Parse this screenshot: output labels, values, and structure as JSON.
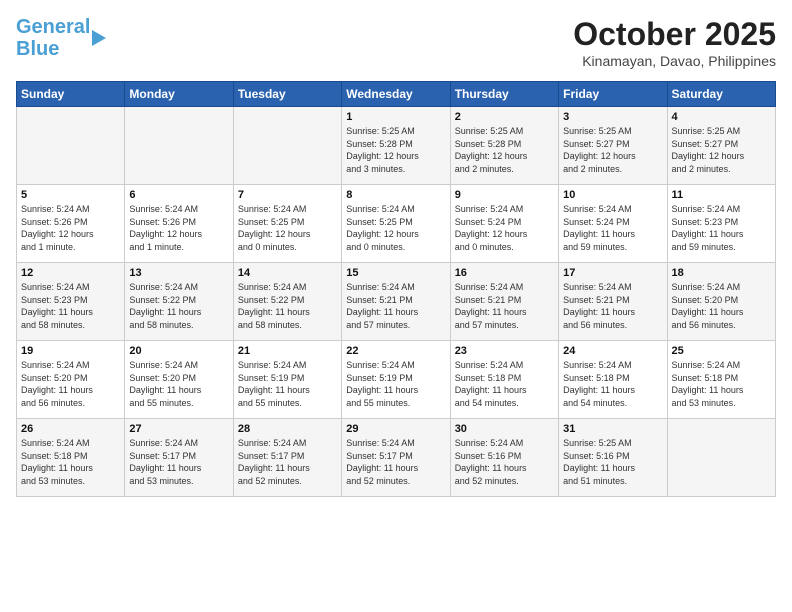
{
  "header": {
    "logo_line1": "General",
    "logo_line2": "Blue",
    "month_title": "October 2025",
    "location": "Kinamayan, Davao, Philippines"
  },
  "weekdays": [
    "Sunday",
    "Monday",
    "Tuesday",
    "Wednesday",
    "Thursday",
    "Friday",
    "Saturday"
  ],
  "weeks": [
    [
      {
        "day": "",
        "info": ""
      },
      {
        "day": "",
        "info": ""
      },
      {
        "day": "",
        "info": ""
      },
      {
        "day": "1",
        "info": "Sunrise: 5:25 AM\nSunset: 5:28 PM\nDaylight: 12 hours\nand 3 minutes."
      },
      {
        "day": "2",
        "info": "Sunrise: 5:25 AM\nSunset: 5:28 PM\nDaylight: 12 hours\nand 2 minutes."
      },
      {
        "day": "3",
        "info": "Sunrise: 5:25 AM\nSunset: 5:27 PM\nDaylight: 12 hours\nand 2 minutes."
      },
      {
        "day": "4",
        "info": "Sunrise: 5:25 AM\nSunset: 5:27 PM\nDaylight: 12 hours\nand 2 minutes."
      }
    ],
    [
      {
        "day": "5",
        "info": "Sunrise: 5:24 AM\nSunset: 5:26 PM\nDaylight: 12 hours\nand 1 minute."
      },
      {
        "day": "6",
        "info": "Sunrise: 5:24 AM\nSunset: 5:26 PM\nDaylight: 12 hours\nand 1 minute."
      },
      {
        "day": "7",
        "info": "Sunrise: 5:24 AM\nSunset: 5:25 PM\nDaylight: 12 hours\nand 0 minutes."
      },
      {
        "day": "8",
        "info": "Sunrise: 5:24 AM\nSunset: 5:25 PM\nDaylight: 12 hours\nand 0 minutes."
      },
      {
        "day": "9",
        "info": "Sunrise: 5:24 AM\nSunset: 5:24 PM\nDaylight: 12 hours\nand 0 minutes."
      },
      {
        "day": "10",
        "info": "Sunrise: 5:24 AM\nSunset: 5:24 PM\nDaylight: 11 hours\nand 59 minutes."
      },
      {
        "day": "11",
        "info": "Sunrise: 5:24 AM\nSunset: 5:23 PM\nDaylight: 11 hours\nand 59 minutes."
      }
    ],
    [
      {
        "day": "12",
        "info": "Sunrise: 5:24 AM\nSunset: 5:23 PM\nDaylight: 11 hours\nand 58 minutes."
      },
      {
        "day": "13",
        "info": "Sunrise: 5:24 AM\nSunset: 5:22 PM\nDaylight: 11 hours\nand 58 minutes."
      },
      {
        "day": "14",
        "info": "Sunrise: 5:24 AM\nSunset: 5:22 PM\nDaylight: 11 hours\nand 58 minutes."
      },
      {
        "day": "15",
        "info": "Sunrise: 5:24 AM\nSunset: 5:21 PM\nDaylight: 11 hours\nand 57 minutes."
      },
      {
        "day": "16",
        "info": "Sunrise: 5:24 AM\nSunset: 5:21 PM\nDaylight: 11 hours\nand 57 minutes."
      },
      {
        "day": "17",
        "info": "Sunrise: 5:24 AM\nSunset: 5:21 PM\nDaylight: 11 hours\nand 56 minutes."
      },
      {
        "day": "18",
        "info": "Sunrise: 5:24 AM\nSunset: 5:20 PM\nDaylight: 11 hours\nand 56 minutes."
      }
    ],
    [
      {
        "day": "19",
        "info": "Sunrise: 5:24 AM\nSunset: 5:20 PM\nDaylight: 11 hours\nand 56 minutes."
      },
      {
        "day": "20",
        "info": "Sunrise: 5:24 AM\nSunset: 5:20 PM\nDaylight: 11 hours\nand 55 minutes."
      },
      {
        "day": "21",
        "info": "Sunrise: 5:24 AM\nSunset: 5:19 PM\nDaylight: 11 hours\nand 55 minutes."
      },
      {
        "day": "22",
        "info": "Sunrise: 5:24 AM\nSunset: 5:19 PM\nDaylight: 11 hours\nand 55 minutes."
      },
      {
        "day": "23",
        "info": "Sunrise: 5:24 AM\nSunset: 5:18 PM\nDaylight: 11 hours\nand 54 minutes."
      },
      {
        "day": "24",
        "info": "Sunrise: 5:24 AM\nSunset: 5:18 PM\nDaylight: 11 hours\nand 54 minutes."
      },
      {
        "day": "25",
        "info": "Sunrise: 5:24 AM\nSunset: 5:18 PM\nDaylight: 11 hours\nand 53 minutes."
      }
    ],
    [
      {
        "day": "26",
        "info": "Sunrise: 5:24 AM\nSunset: 5:18 PM\nDaylight: 11 hours\nand 53 minutes."
      },
      {
        "day": "27",
        "info": "Sunrise: 5:24 AM\nSunset: 5:17 PM\nDaylight: 11 hours\nand 53 minutes."
      },
      {
        "day": "28",
        "info": "Sunrise: 5:24 AM\nSunset: 5:17 PM\nDaylight: 11 hours\nand 52 minutes."
      },
      {
        "day": "29",
        "info": "Sunrise: 5:24 AM\nSunset: 5:17 PM\nDaylight: 11 hours\nand 52 minutes."
      },
      {
        "day": "30",
        "info": "Sunrise: 5:24 AM\nSunset: 5:16 PM\nDaylight: 11 hours\nand 52 minutes."
      },
      {
        "day": "31",
        "info": "Sunrise: 5:25 AM\nSunset: 5:16 PM\nDaylight: 11 hours\nand 51 minutes."
      },
      {
        "day": "",
        "info": ""
      }
    ]
  ]
}
